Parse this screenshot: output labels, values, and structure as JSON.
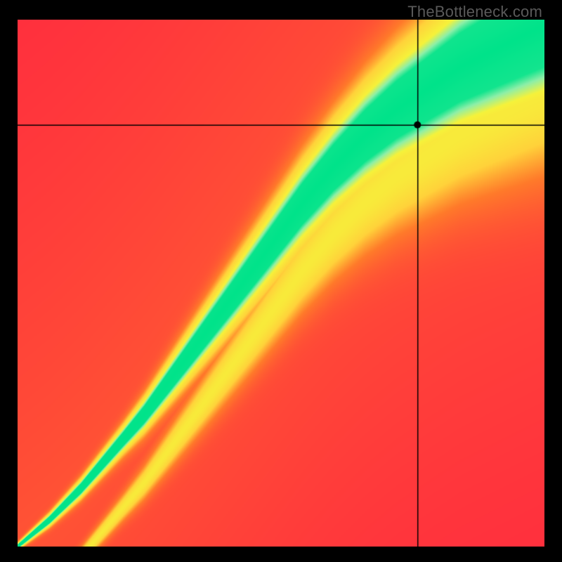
{
  "watermark": "TheBottleneck.com",
  "chart_data": {
    "type": "heatmap",
    "title": "",
    "xlabel": "",
    "ylabel": "",
    "xlim": [
      0,
      100
    ],
    "ylim": [
      0,
      100
    ],
    "grid": false,
    "legend": false,
    "colormap_stops": [
      {
        "t": 0.0,
        "color": "#ff2a3f"
      },
      {
        "t": 0.35,
        "color": "#ff7a2a"
      },
      {
        "t": 0.55,
        "color": "#ffd23a"
      },
      {
        "t": 0.78,
        "color": "#f6f23a"
      },
      {
        "t": 0.9,
        "color": "#8defa8"
      },
      {
        "t": 1.0,
        "color": "#00e38a"
      }
    ],
    "optimal_curve": [
      {
        "x": 0,
        "y": 0
      },
      {
        "x": 6,
        "y": 5
      },
      {
        "x": 12,
        "y": 11
      },
      {
        "x": 18,
        "y": 18
      },
      {
        "x": 24,
        "y": 25
      },
      {
        "x": 30,
        "y": 33
      },
      {
        "x": 36,
        "y": 41
      },
      {
        "x": 42,
        "y": 49
      },
      {
        "x": 48,
        "y": 57
      },
      {
        "x": 54,
        "y": 65
      },
      {
        "x": 60,
        "y": 72
      },
      {
        "x": 66,
        "y": 78
      },
      {
        "x": 72,
        "y": 83
      },
      {
        "x": 78,
        "y": 87
      },
      {
        "x": 84,
        "y": 91
      },
      {
        "x": 90,
        "y": 94
      },
      {
        "x": 96,
        "y": 97
      },
      {
        "x": 100,
        "y": 99
      }
    ],
    "ridge_width_profile": [
      {
        "x": 0,
        "half_width": 0.5
      },
      {
        "x": 20,
        "half_width": 2.0
      },
      {
        "x": 40,
        "half_width": 4.5
      },
      {
        "x": 60,
        "half_width": 7.0
      },
      {
        "x": 80,
        "half_width": 10.0
      },
      {
        "x": 100,
        "half_width": 13.0
      }
    ],
    "marker": {
      "x": 76,
      "y": 80,
      "radius_px": 5
    },
    "crosshair": {
      "x": 76,
      "y": 80
    },
    "secondary_ridge": {
      "offset": 13,
      "intensity": 0.58
    },
    "description": "Heatmap of match quality between two component scores. Green diagonal band = balanced match; red corners = severe bottleneck. Black crosshair + dot marks the selected pairing near (76, 80) on a 0–100 scale, sitting on the upper edge of the optimal band."
  }
}
